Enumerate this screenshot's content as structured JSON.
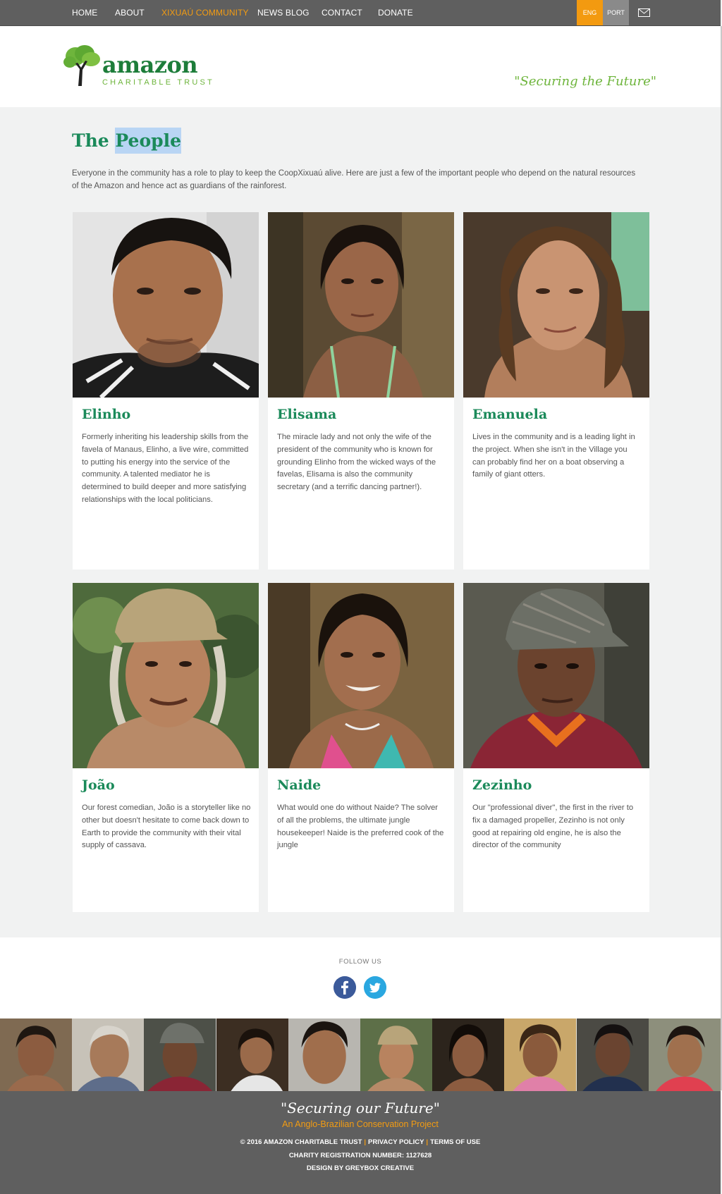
{
  "nav": {
    "items": [
      {
        "label": "HOME"
      },
      {
        "label": "ABOUT"
      },
      {
        "label": "XIXUAÚ COMMUNITY"
      },
      {
        "label": "NEWS BLOG"
      },
      {
        "label": "CONTACT"
      },
      {
        "label": "DONATE"
      }
    ],
    "active_index": 2,
    "languages": [
      "ENG",
      "PORT"
    ],
    "mail_icon": "envelope-icon"
  },
  "header": {
    "logo_word": "amazon",
    "logo_sub": "CHARITABLE TRUST",
    "tagline": "\"Securing the Future\""
  },
  "main": {
    "title_part1": "The",
    "title_part2": "People",
    "intro": "Everyone in the community has a role to play to keep the CoopXixuaú alive. Here are just a few of the important people who depend on the natural resources of the Amazon and hence act as guardians of the rainforest.",
    "people": [
      {
        "name": "Elinho",
        "bio": "Formerly inheriting his leadership skills from the favela of Manaus, Elinho, a live wire, committed to putting his energy into the service of the community. A talented mediator he is determined to build deeper and more satisfying relationships with the local politicians."
      },
      {
        "name": "Elisama",
        "bio": "The miracle lady and not only the wife of the president of the community who is known for grounding Elinho from the wicked ways of the favelas, Elisama is also the community secretary (and a terrific dancing partner!)."
      },
      {
        "name": "Emanuela",
        "bio": "Lives in the community and is a leading light in the project. When she isn't in the Village you can probably find her on a boat observing a family of giant otters."
      },
      {
        "name": "João",
        "bio": "Our forest comedian, João is a storyteller like no other but doesn't hesitate to come back down to Earth to provide the community with their vital supply of cassava."
      },
      {
        "name": "Naide",
        "bio": "What would one do without Naide? The solver of all the problems, the ultimate jungle housekeeper! Naide is the preferred cook of the jungle"
      },
      {
        "name": "Zezinho",
        "bio": "Our \"professional diver\", the first in the river to fix a damaged propeller, Zezinho is not only good at repairing old engine, he is also the director of the community"
      }
    ]
  },
  "follow": {
    "label": "FOLLOW US",
    "icons": [
      "facebook-icon",
      "twitter-icon"
    ]
  },
  "footer": {
    "quote": "\"Securing our Future\"",
    "subtitle": "An Anglo-Brazilian Conservation Project",
    "copyright": "© 2016 AMAZON CHARITABLE TRUST",
    "privacy": "PRIVACY POLICY",
    "terms": "TERMS OF USE",
    "registration": "CHARITY REGISTRATION NUMBER: 1127628",
    "design": "DESIGN BY GREYBOX CREATIVE"
  },
  "colors": {
    "accent_orange": "#f39c12",
    "brand_green": "#1b8a5a",
    "leaf_green": "#6eb53c",
    "nav_bg": "#5f5f5f"
  }
}
